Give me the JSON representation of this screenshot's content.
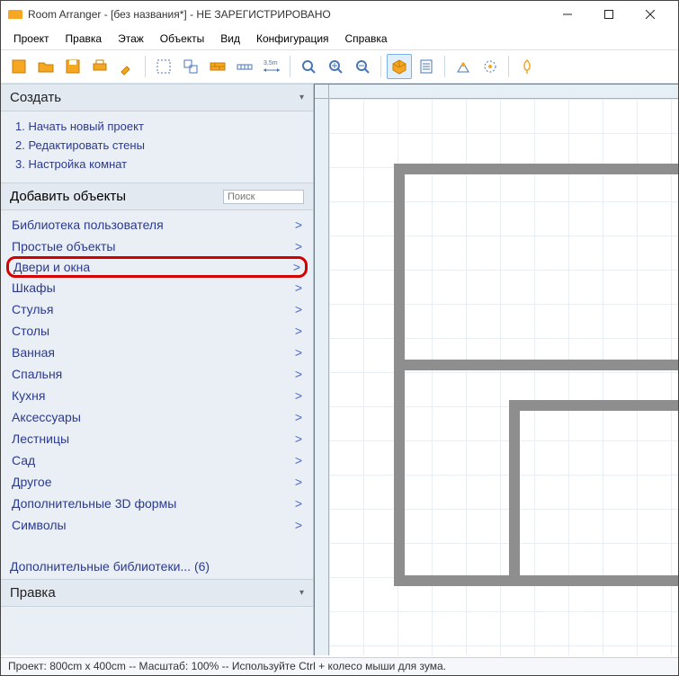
{
  "window": {
    "title": "Room Arranger - [без названия*] - НЕ ЗАРЕГИСТРИРОВАНО"
  },
  "menu": {
    "project": "Проект",
    "edit": "Правка",
    "floor": "Этаж",
    "objects": "Объекты",
    "view": "Вид",
    "config": "Конфигурация",
    "help": "Справка"
  },
  "sidebar": {
    "create": {
      "title": "Создать",
      "steps": [
        "1. Начать новый проект",
        "2. Редактировать стены",
        "3. Настройка комнат"
      ]
    },
    "add": {
      "title": "Добавить объекты",
      "search_placeholder": "Поиск",
      "categories": [
        "Библиотека пользователя",
        "Простые объекты",
        "Двери и окна",
        "Шкафы",
        "Стулья",
        "Столы",
        "Ванная",
        "Спальня",
        "Кухня",
        "Аксессуары",
        "Лестницы",
        "Сад",
        "Другое",
        "Дополнительные 3D формы",
        "Символы"
      ],
      "extra_libs": "Дополнительные библиотеки... (6)"
    },
    "edit_panel": {
      "title": "Правка"
    }
  },
  "status": "Проект: 800cm x 400cm -- Масштаб: 100% -- Используйте Ctrl + колесо мыши для зума.",
  "toolbar_icons": [
    "new",
    "open",
    "save",
    "print",
    "tool1",
    "select",
    "group",
    "wall",
    "measure",
    "dim35",
    "zoom-extent",
    "zoom-in",
    "zoom-out",
    "view3d",
    "properties",
    "export",
    "library",
    "click"
  ],
  "highlighted_category_index": 2
}
